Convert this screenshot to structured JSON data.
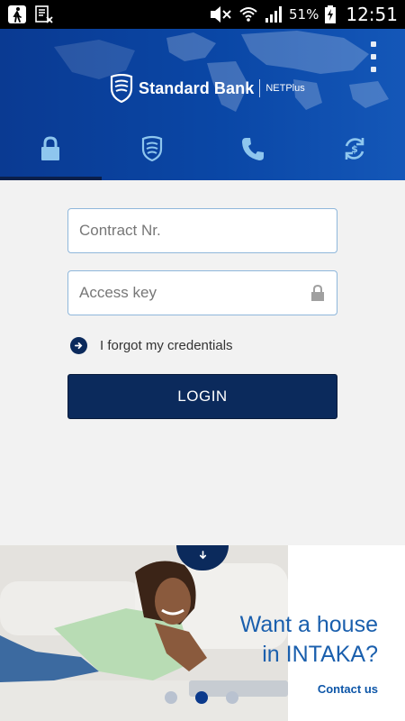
{
  "status_bar": {
    "battery_percent": "51%",
    "time": "12:51",
    "left_icons": [
      "person-walking-icon",
      "notification-icon"
    ],
    "right_icons": [
      "mute-icon",
      "wifi-icon",
      "signal-icon",
      "battery-charging-icon"
    ]
  },
  "header": {
    "brand": "Standard Bank",
    "product": "NETPlus",
    "menu_icon": "overflow-menu-icon",
    "tabs": [
      {
        "icon": "lock-icon",
        "active": true
      },
      {
        "icon": "bank-shield-icon",
        "active": false
      },
      {
        "icon": "phone-icon",
        "active": false
      },
      {
        "icon": "currency-exchange-icon",
        "active": false
      }
    ]
  },
  "form": {
    "contract_placeholder": "Contract Nr.",
    "contract_value": "",
    "access_key_placeholder": "Access key",
    "access_key_value": "",
    "forgot_label": "I forgot my credentials",
    "login_label": "LOGIN"
  },
  "banner": {
    "headline_line1": "Want a house",
    "headline_line2": "in INTAKA?",
    "cta": "Contact us",
    "pager": {
      "count": 3,
      "active_index": 1
    }
  },
  "colors": {
    "header_blue": "#0a47a6",
    "navy": "#0b2a5c",
    "accent_text_blue": "#1a5fad",
    "field_border": "#8fb7db",
    "background": "#f2f2f2"
  }
}
